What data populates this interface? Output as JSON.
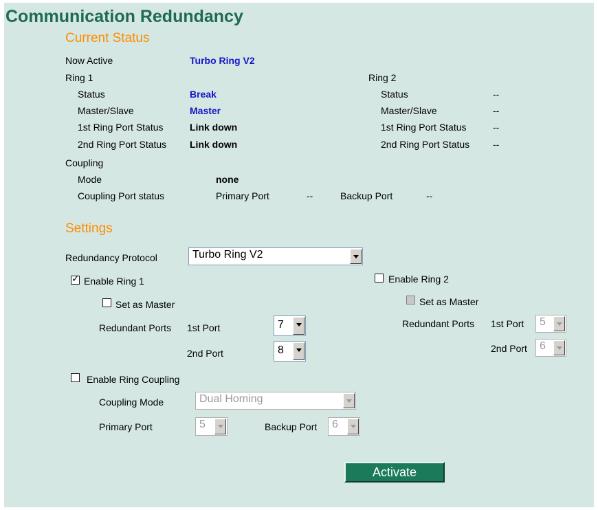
{
  "page": {
    "title": "Communication Redundancy"
  },
  "current_status": {
    "heading": "Current Status",
    "now_active_label": "Now Active",
    "now_active_value": "Turbo Ring V2",
    "ring1": {
      "label": "Ring 1",
      "status_label": "Status",
      "status_value": "Break",
      "master_slave_label": "Master/Slave",
      "master_slave_value": "Master",
      "port1_label": "1st Ring Port Status",
      "port1_value": "Link down",
      "port2_label": "2nd Ring Port Status",
      "port2_value": "Link down"
    },
    "ring2": {
      "label": "Ring 2",
      "status_label": "Status",
      "status_value": "--",
      "master_slave_label": "Master/Slave",
      "master_slave_value": "--",
      "port1_label": "1st Ring Port Status",
      "port1_value": "--",
      "port2_label": "2nd Ring Port Status",
      "port2_value": "--"
    },
    "coupling": {
      "label": "Coupling",
      "mode_label": "Mode",
      "mode_value": "none",
      "port_status_label": "Coupling Port status",
      "primary_label": "Primary Port",
      "primary_value": "--",
      "backup_label": "Backup Port",
      "backup_value": "--"
    }
  },
  "settings": {
    "heading": "Settings",
    "protocol_label": "Redundancy Protocol",
    "protocol_value": "Turbo Ring V2",
    "ring1": {
      "enable_label": "Enable Ring 1",
      "enabled": true,
      "master_label": "Set as Master",
      "master_checked": false,
      "ports_label": "Redundant Ports",
      "port1_label": "1st Port",
      "port1_value": "7",
      "port2_label": "2nd Port",
      "port2_value": "8"
    },
    "ring2": {
      "enable_label": "Enable Ring 2",
      "enabled": false,
      "master_label": "Set as Master",
      "master_checked": false,
      "ports_label": "Redundant Ports",
      "port1_label": "1st Port",
      "port1_value": "5",
      "port2_label": "2nd Port",
      "port2_value": "6"
    },
    "coupling": {
      "enable_label": "Enable Ring Coupling",
      "enabled": false,
      "mode_label": "Coupling Mode",
      "mode_value": "Dual Homing",
      "primary_label": "Primary Port",
      "primary_value": "5",
      "backup_label": "Backup Port",
      "backup_value": "6"
    },
    "activate_label": "Activate"
  },
  "colors": {
    "panel_bg": "#d4e7e2",
    "title": "#1f6a54",
    "section_heading": "#ff8c00",
    "status_value": "#1414c8",
    "button_bg": "#1b7a5a"
  },
  "icons": {
    "dropdown": "chevron-down-icon",
    "checkbox_checked": "check-icon"
  }
}
